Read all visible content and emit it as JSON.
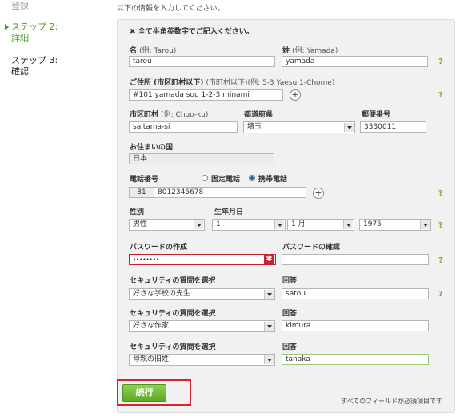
{
  "sidebar": {
    "step1": "登録",
    "step2_title": "ステップ 2:",
    "step2_sub": "詳細",
    "step3_title": "ステップ 3:",
    "step3_sub": "確認"
  },
  "intro": "以下の情報を入力してください。",
  "form": {
    "notice_mark": "✖",
    "notice": "全て半角英数字でご記入ください。",
    "first_name_label": "名",
    "first_name_hint": "(例: Tarou)",
    "first_name_value": "tarou",
    "last_name_label": "姓",
    "last_name_hint": "(例: Yamada)",
    "last_name_value": "yamada",
    "address_label": "ご住所 (市区町村以下)",
    "address_hint": "(市町村以下)(例: 5-3 Yaesu 1-Chome)",
    "address_value": "#101 yamada sou  1-2-3 minami",
    "city_label": "市区町村",
    "city_hint": "(例: Chuo-ku)",
    "city_value": "saitama-si",
    "prefecture_label": "都道府県",
    "prefecture_value": "埼玉",
    "postal_label": "郵便番号",
    "postal_value": "3330011",
    "country_label": "お住まいの国",
    "country_value": "日本",
    "phone_label": "電話番号",
    "phone_type_landline": "固定電話",
    "phone_type_mobile": "携帯電話",
    "phone_country_code": "81",
    "phone_value": "8012345678",
    "gender_label": "性別",
    "gender_value": "男性",
    "birthday_label": "生年月日",
    "birth_day": "1",
    "birth_month": "1 月",
    "birth_year": "1975",
    "password_label": "パスワードの作成",
    "password_value": "••••••••",
    "password_confirm_label": "パスワードの確認",
    "password_confirm_value": "",
    "security_q_label": "セキュリティの質問を選択",
    "answer_label": "回答",
    "q1": "好きな学校の先生",
    "a1": "satou",
    "q2": "好きな作家",
    "a2": "kimura",
    "q3": "母親の旧姓",
    "a3": "tanaka",
    "help_glyph": "?",
    "plus_glyph": "+",
    "error_glyph": "✱"
  },
  "footer": {
    "continue_label": "続行",
    "required_note": "すべてのフィールドが必須項目です"
  }
}
